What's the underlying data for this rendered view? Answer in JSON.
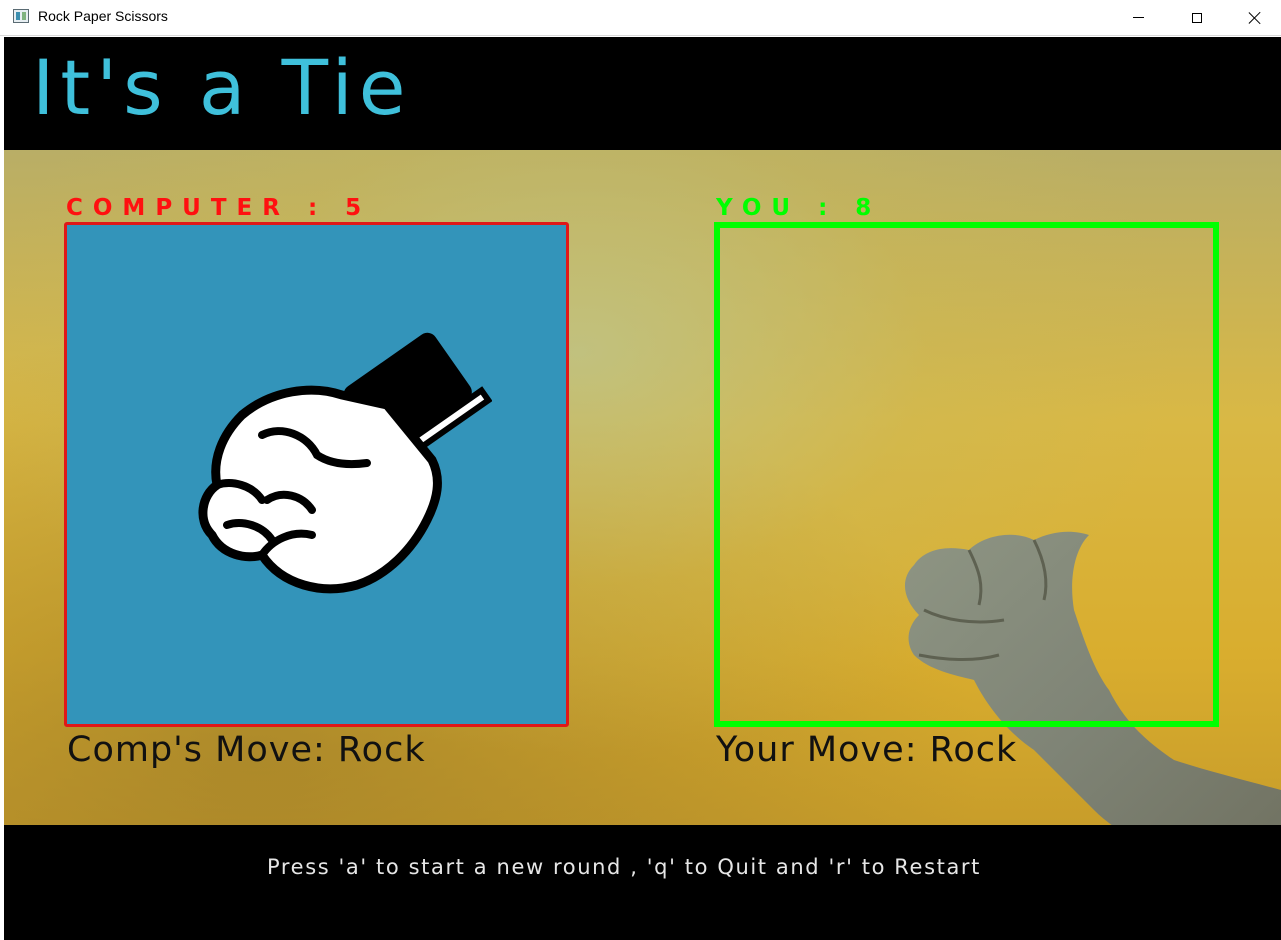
{
  "window": {
    "title": "Rock Paper Scissors"
  },
  "game": {
    "result_text": "It's a Tie",
    "computer_score_label": "COMPUTER : 5",
    "player_score_label": "YOU : 8",
    "computer_move_label": "Comp's Move: Rock",
    "player_move_label": "Your Move: Rock",
    "instructions": "Press 'a' to start a new round , 'q' to Quit and 'r' to Restart"
  },
  "colors": {
    "result_text": "#3fc0db",
    "computer_accent": "#ff1010",
    "player_accent": "#00ff00",
    "computer_panel_bg": "#3394ba"
  },
  "icons": {
    "computer_move_icon": "rock-fist-icon"
  }
}
